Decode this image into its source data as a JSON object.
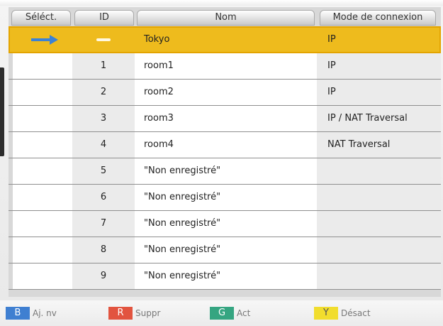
{
  "columns": {
    "select": "Séléct.",
    "id": "ID",
    "name": "Nom",
    "mode": "Mode de connexion"
  },
  "rows": [
    {
      "id": "",
      "name": "Tokyo",
      "mode": "IP",
      "selected": true
    },
    {
      "id": "1",
      "name": "room1",
      "mode": "IP"
    },
    {
      "id": "2",
      "name": "room2",
      "mode": "IP"
    },
    {
      "id": "3",
      "name": "room3",
      "mode": "IP / NAT Traversal"
    },
    {
      "id": "4",
      "name": "room4",
      "mode": "NAT Traversal"
    },
    {
      "id": "5",
      "name": "\"Non enregistré\"",
      "mode": ""
    },
    {
      "id": "6",
      "name": "\"Non enregistré\"",
      "mode": ""
    },
    {
      "id": "7",
      "name": "\"Non enregistré\"",
      "mode": ""
    },
    {
      "id": "8",
      "name": "\"Non enregistré\"",
      "mode": ""
    },
    {
      "id": "9",
      "name": "\"Non enregistré\"",
      "mode": ""
    }
  ],
  "footer": {
    "keys": [
      {
        "key": "B",
        "label": "Aj. nv",
        "color": "#3f7fd1"
      },
      {
        "key": "R",
        "label": "Suppr",
        "color": "#e2543f"
      },
      {
        "key": "G",
        "label": "Act",
        "color": "#35a581"
      },
      {
        "key": "Y",
        "label": "Désact",
        "color": "#f1dd2d"
      }
    ]
  },
  "colors": {
    "selection": "#eebb1d",
    "arrow": "#3b82d6"
  },
  "icons": {
    "selected_row_marker": "right-arrow-icon",
    "self_id_marker": "dash-icon"
  }
}
